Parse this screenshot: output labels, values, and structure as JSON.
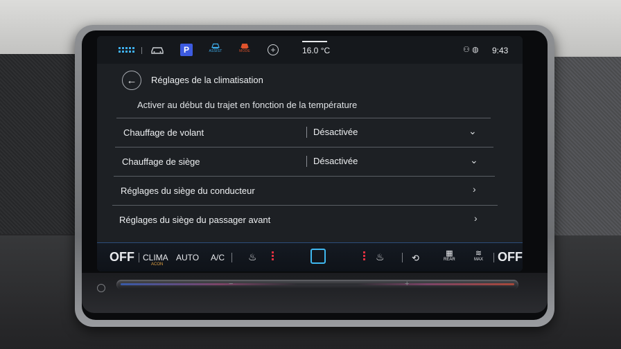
{
  "status_bar": {
    "icons": [
      "grid-apps-icon",
      "car-icon",
      "parking-icon",
      "assist-icon",
      "mode-icon",
      "add-circle-icon",
      "driver-profile-icon",
      "globe-icon"
    ],
    "parking_label": "P",
    "assist_label": "ASSIST",
    "mode_label": "MODE",
    "temperature": "16.0 °C",
    "time": "9:43"
  },
  "header": {
    "title": "Réglages de la climatisation",
    "back_icon": "arrow-left-icon"
  },
  "subtitle": "Activer au début du trajet en fonction de la température",
  "settings": [
    {
      "label": "Chauffage de volant",
      "value": "Désactivée",
      "control": "chevron-down-icon"
    },
    {
      "label": "Chauffage de siège",
      "value": "Désactivée",
      "control": "chevron-down-icon"
    },
    {
      "label": "Réglages du siège du conducteur",
      "control": "chevron-right-icon"
    },
    {
      "label": "Réglages du siège du passager avant",
      "control": "chevron-right-icon"
    }
  ],
  "clima_bar": {
    "left_off": "OFF",
    "clima": "CLIMA",
    "clima_sub": "ACON",
    "auto": "AUTO",
    "ac": "A/C",
    "rear_label": "REAR",
    "max_label": "MAX",
    "right_off": "OFF"
  },
  "colors": {
    "accent_blue": "#3fb0f0",
    "heat_red": "#e03040",
    "screen_bg": "#1d2024"
  }
}
